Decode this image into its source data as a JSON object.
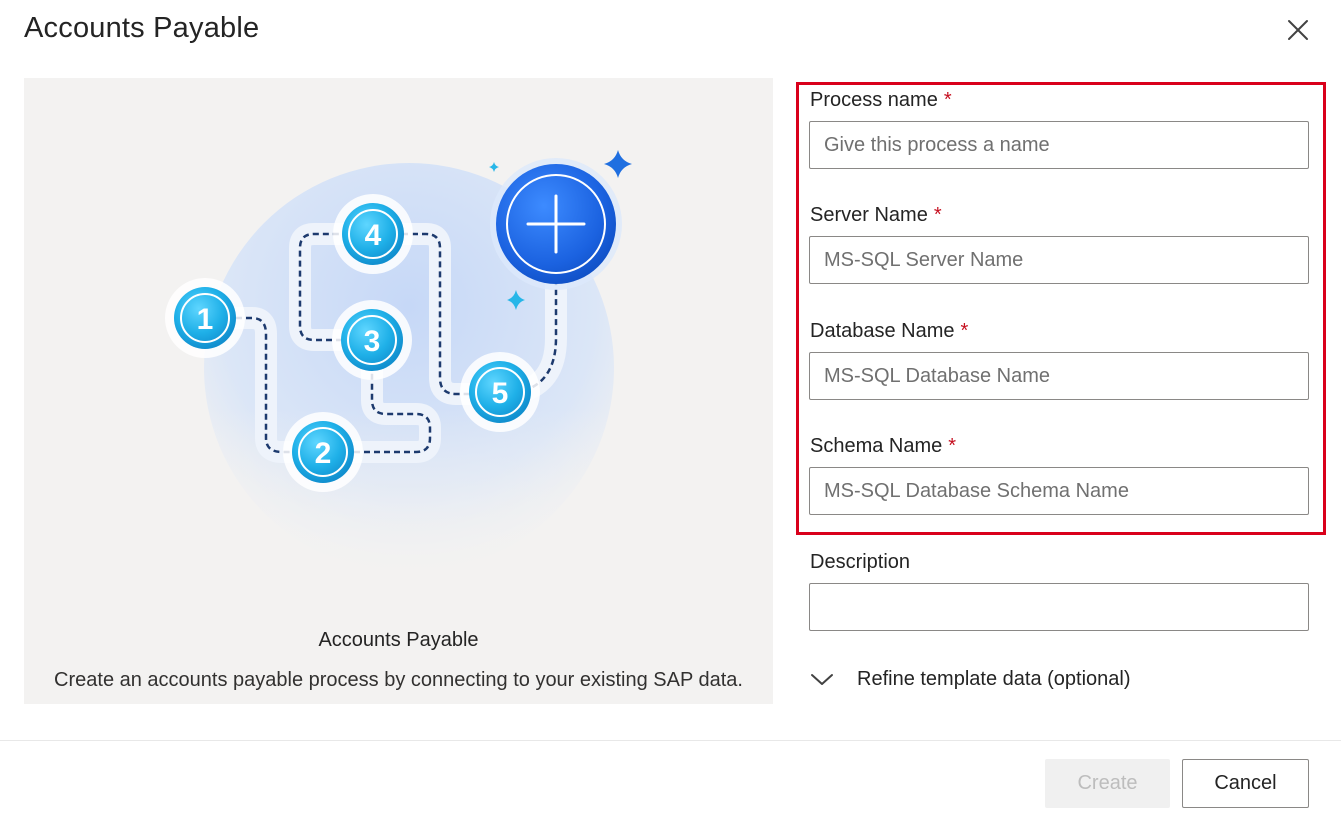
{
  "dialog": {
    "title": "Accounts Payable",
    "close_icon": "close-icon"
  },
  "preview": {
    "title": "Accounts Payable",
    "description": "Create an accounts payable process by connecting to your existing SAP data.",
    "steps": [
      "1",
      "2",
      "3",
      "4",
      "5"
    ]
  },
  "form": {
    "process_name": {
      "label": "Process name",
      "required": "*",
      "placeholder": "Give this process a name",
      "value": ""
    },
    "server_name": {
      "label": "Server Name",
      "required": "*",
      "placeholder": "MS-SQL Server Name",
      "value": ""
    },
    "database_name": {
      "label": "Database Name",
      "required": "*",
      "placeholder": "MS-SQL Database Name",
      "value": ""
    },
    "schema_name": {
      "label": "Schema Name",
      "required": "*",
      "placeholder": "MS-SQL Database Schema Name",
      "value": ""
    },
    "description": {
      "label": "Description",
      "value": ""
    },
    "refine": {
      "label": "Refine template data (optional)",
      "icon": "chevron-down-icon"
    }
  },
  "footer": {
    "create_label": "Create",
    "cancel_label": "Cancel"
  },
  "colors": {
    "highlight": "#d9001b",
    "required": "#c50f1f",
    "accent_blue": "#1f6fe0",
    "step_cyan": "#27b6e8"
  }
}
